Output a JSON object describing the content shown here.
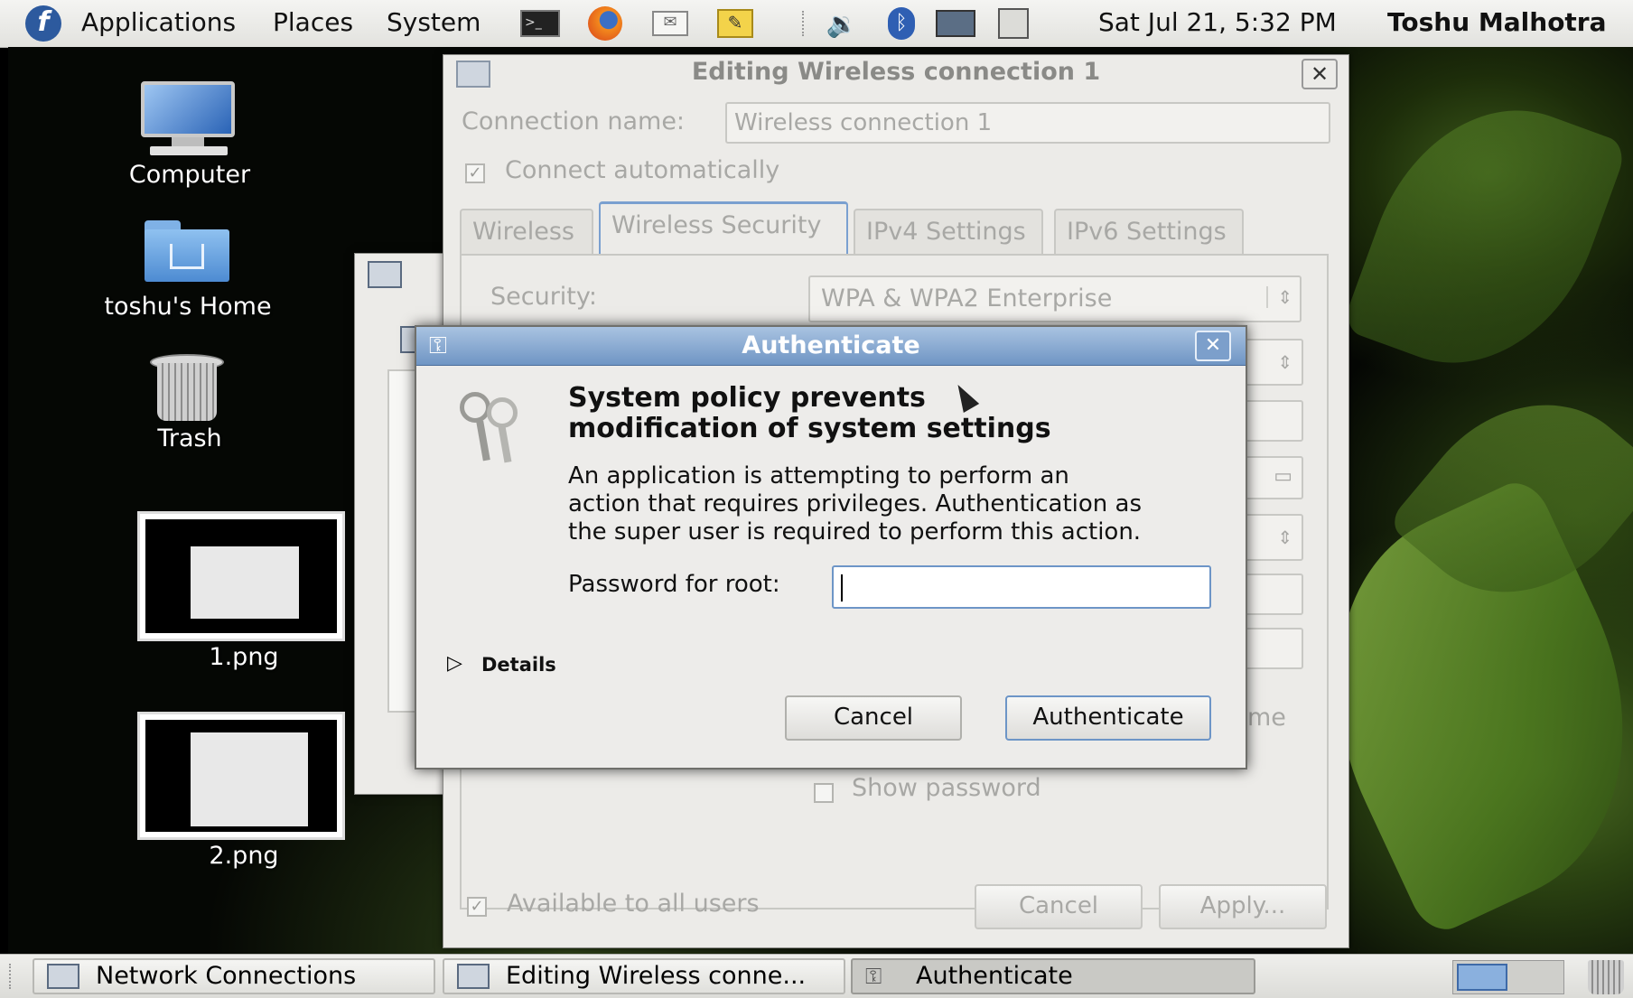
{
  "top_panel": {
    "menus": [
      "Applications",
      "Places",
      "System"
    ],
    "clock": "Sat Jul 21,  5:32 PM",
    "user": "Toshu Malhotra",
    "launchers": [
      "terminal-icon",
      "firefox-icon",
      "mail-icon",
      "notes-icon"
    ],
    "tray": [
      "volume-icon",
      "bluetooth-icon",
      "network-icon",
      "battery-icon"
    ]
  },
  "desktop_icons": {
    "computer": "Computer",
    "home": "toshu's Home",
    "trash": "Trash",
    "file1": "1.png",
    "file2": "2.png"
  },
  "edit_window": {
    "title": "Editing Wireless connection 1",
    "connection_name_label": "Connection name:",
    "connection_name_value": "Wireless connection 1",
    "connect_automatically": "Connect automatically",
    "tabs": [
      "Wireless",
      "Wireless Security",
      "IPv4 Settings",
      "IPv6 Settings"
    ],
    "active_tab": "Wireless Security",
    "security_label": "Security:",
    "security_value": "WPA & WPA2 Enterprise",
    "partial_text": "me",
    "show_password": "Show password",
    "available_all_users": "Available to all users",
    "cancel": "Cancel",
    "apply": "Apply..."
  },
  "auth_dialog": {
    "title": "Authenticate",
    "heading_line1": "System policy prevents",
    "heading_line2": "modification of system settings",
    "body_line1": "An application is attempting to perform an",
    "body_line2": "action that requires privileges. Authentication as",
    "body_line3": "the super user is required to perform this action.",
    "password_label": "Password for root:",
    "password_value": "",
    "details": "Details",
    "cancel": "Cancel",
    "authenticate": "Authenticate"
  },
  "taskbar": {
    "tasks": [
      "Network Connections",
      "Editing Wireless conne...",
      "Authenticate"
    ],
    "active_task": "Authenticate"
  }
}
